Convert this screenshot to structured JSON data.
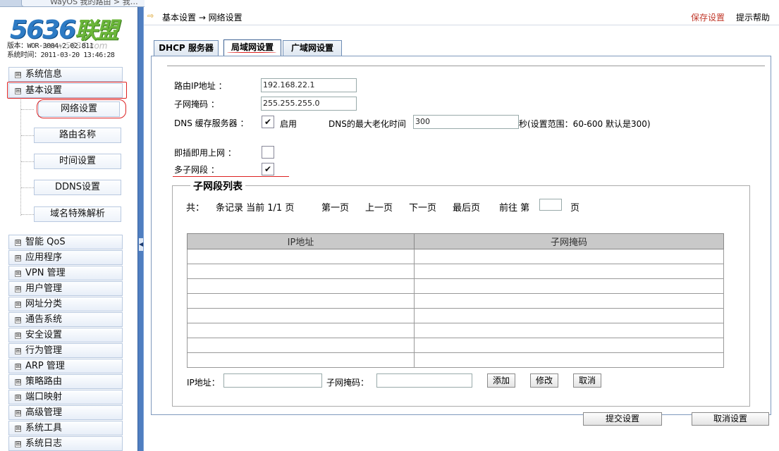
{
  "browser_tab": {
    "title": "WayOS 我的路由 > 我…",
    "close": "×"
  },
  "logo": {
    "number": "5636",
    "text": "联盟",
    "watermark": "www.5636.com"
  },
  "version": "版本：WOR-3004-2.02.811",
  "system_time": "系统时间：2011-03-20 13:46:28",
  "sidebar": {
    "top_items": [
      {
        "label": "系统信息",
        "expander": "⊞"
      },
      {
        "label": "基本设置",
        "expander": "⊞"
      }
    ],
    "sub_items": [
      {
        "label": "网络设置"
      },
      {
        "label": "路由名称"
      },
      {
        "label": "时间设置"
      },
      {
        "label": "DDNS设置"
      },
      {
        "label": "域名特殊解析"
      }
    ],
    "items": [
      {
        "label": "智能 QoS",
        "expander": "⊞"
      },
      {
        "label": "应用程序",
        "expander": "⊞"
      },
      {
        "label": "VPN 管理",
        "expander": "⊞"
      },
      {
        "label": "用户管理",
        "expander": "⊞"
      },
      {
        "label": "网址分类",
        "expander": "⊞"
      },
      {
        "label": "通告系统",
        "expander": "⊞"
      },
      {
        "label": "安全设置",
        "expander": "⊞"
      },
      {
        "label": "行为管理",
        "expander": "⊞"
      },
      {
        "label": "ARP 管理",
        "expander": "⊞"
      },
      {
        "label": "策略路由",
        "expander": "⊞"
      },
      {
        "label": "端口映射",
        "expander": "⊞"
      },
      {
        "label": "高级管理",
        "expander": "⊞"
      },
      {
        "label": "系统工具",
        "expander": "⊞"
      },
      {
        "label": "系统日志",
        "expander": "⊞"
      }
    ]
  },
  "splitter": {
    "arrow": "◀"
  },
  "header": {
    "icon": "⇨",
    "breadcrumb": "基本设置 → 网络设置",
    "save": "保存设置",
    "help": "提示帮助"
  },
  "tabs": [
    {
      "label": "DHCP 服务器"
    },
    {
      "label": "局域网设置"
    },
    {
      "label": "广域网设置"
    }
  ],
  "form": {
    "router_ip_label": "路由IP地址 ：",
    "router_ip": "192.168.22.1",
    "subnet_label": "子网掩码 ：",
    "subnet": "255.255.255.0",
    "dns_label": "DNS 缓存服务器 ：",
    "dns_check": "✔",
    "dns_enable": "启用",
    "dns_max_label": "DNS的最大老化时间",
    "dns_max_value": "300",
    "dns_hint": "秒(设置范围：60-600 默认是300)",
    "plug_label": "即插即用上网 ：",
    "plug_check": "",
    "multi_label": "多子网段 ：",
    "multi_check": "✔"
  },
  "subnet_list": {
    "legend": "子网段列表",
    "pager": {
      "total": "共：",
      "records": "条记录 当前 1/1 页",
      "first": "第一页",
      "prev": "上一页",
      "next": "下一页",
      "last": "最后页",
      "goto": "前往 第",
      "goto_value": "",
      "page": "页"
    },
    "columns": [
      "IP地址",
      "子网掩码"
    ],
    "ip_label": "IP地址：",
    "mask_label": "子网掩码：",
    "add": "添加",
    "modify": "修改",
    "cancel": "取消"
  },
  "footer": {
    "submit": "提交设置",
    "cancel": "取消设置"
  }
}
